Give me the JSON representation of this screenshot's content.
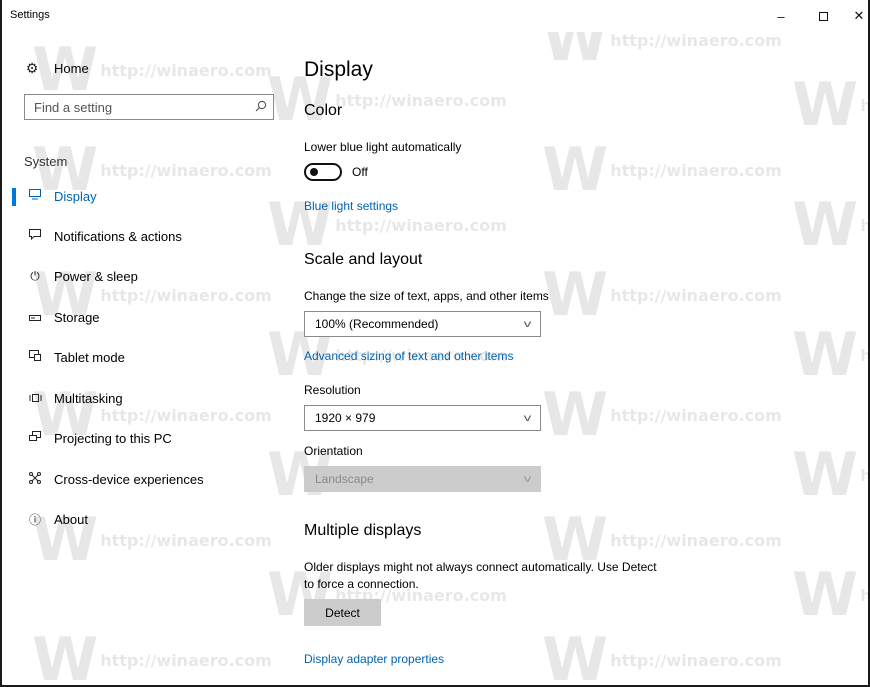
{
  "window": {
    "title": "Settings",
    "minimize_glyph": "–",
    "close_glyph": "✕"
  },
  "sidebar": {
    "home_label": "Home",
    "search_placeholder": "Find a setting",
    "section_label": "System",
    "items": [
      {
        "label": "Display",
        "icon": "monitor-icon",
        "active": true
      },
      {
        "label": "Notifications & actions",
        "icon": "notification-icon",
        "active": false
      },
      {
        "label": "Power & sleep",
        "icon": "power-icon",
        "active": false
      },
      {
        "label": "Storage",
        "icon": "storage-icon",
        "active": false
      },
      {
        "label": "Tablet mode",
        "icon": "tablet-mode-icon",
        "active": false
      },
      {
        "label": "Multitasking",
        "icon": "multitasking-icon",
        "active": false
      },
      {
        "label": "Projecting to this PC",
        "icon": "projecting-icon",
        "active": false
      },
      {
        "label": "Cross-device experiences",
        "icon": "cross-device-icon",
        "active": false
      },
      {
        "label": "About",
        "icon": "info-icon",
        "active": false
      }
    ]
  },
  "main": {
    "page_title": "Display",
    "color": {
      "heading": "Color",
      "night_light_label": "Lower blue light automatically",
      "night_light_state": "Off",
      "blue_light_link": "Blue light settings"
    },
    "scale": {
      "heading": "Scale and layout",
      "size_label": "Change the size of text, apps, and other items",
      "size_value": "100% (Recommended)",
      "advanced_link": "Advanced sizing of text and other items",
      "resolution_label": "Resolution",
      "resolution_value": "1920 × 979",
      "orientation_label": "Orientation",
      "orientation_value": "Landscape"
    },
    "multiple": {
      "heading": "Multiple displays",
      "description_line1": "Older displays might not always connect automatically. Use Detect",
      "description_line2": "to force a connection.",
      "detect_button": "Detect",
      "adapter_link": "Display adapter properties"
    }
  },
  "watermark": {
    "letter": "W",
    "url": "http://winaero.com"
  },
  "colors": {
    "accent": "#0078d7",
    "link": "#0063b1",
    "disabled_bg": "#cccccc"
  }
}
